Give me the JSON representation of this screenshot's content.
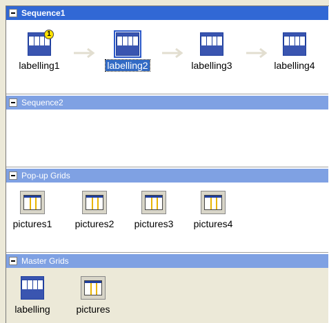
{
  "sections": [
    {
      "title": "Sequence1",
      "state": "active",
      "items": [
        {
          "label": "labelling1",
          "badge": "1"
        },
        {
          "label": "labelling2",
          "selected": true
        },
        {
          "label": "labelling3"
        },
        {
          "label": "labelling4"
        }
      ]
    },
    {
      "title": "Sequence2",
      "state": "inactive",
      "items": []
    },
    {
      "title": "Pop-up Grids",
      "state": "inactive",
      "items": [
        {
          "label": "pictures1"
        },
        {
          "label": "pictures2"
        },
        {
          "label": "pictures3"
        },
        {
          "label": "pictures4"
        }
      ]
    },
    {
      "title": "Master Grids",
      "state": "inactive",
      "items": [
        {
          "label": "labelling"
        },
        {
          "label": "pictures"
        }
      ]
    }
  ],
  "icons": {
    "collapse": "collapse-icon",
    "sequence_arrow": "right-arrow-icon",
    "grid_thumbnail": "grid-thumbnail-icon",
    "popup_thumbnail": "popup-grid-thumbnail-icon"
  },
  "colors": {
    "active_header": "#3168d5",
    "inactive_header": "#7fa1e3",
    "selection": "#316ac5",
    "window_bg": "#ece9d8"
  }
}
